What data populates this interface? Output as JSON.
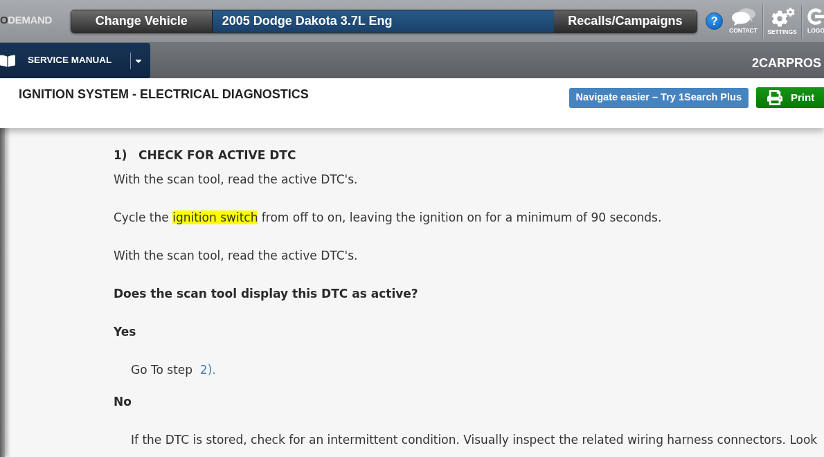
{
  "header": {
    "logo": {
      "prefix": "O",
      "suffix": "DEMAND"
    },
    "change_vehicle": "Change Vehicle",
    "vehicle": "2005 Dodge Dakota 3.7L Eng",
    "recalls": "Recalls/Campaigns",
    "help": "?",
    "actions": [
      {
        "kind": "contact",
        "label": "CONTACT"
      },
      {
        "kind": "settings",
        "label": "SETTINGS"
      },
      {
        "kind": "logout",
        "label": "LOGO"
      }
    ]
  },
  "nav": {
    "module": "SERVICE MANUAL",
    "brand": "2CARPROS"
  },
  "page": {
    "title": "IGNITION SYSTEM - ELECTRICAL DIAGNOSTICS",
    "buttons": [
      {
        "kind": "promo",
        "label": "Navigate easier – Try 1Search Plus"
      },
      {
        "kind": "print",
        "label": "Print"
      }
    ]
  },
  "step": {
    "number": "1)",
    "title": "CHECK FOR ACTIVE DTC",
    "blocks": [
      {
        "kind": "paragraph",
        "segments": [
          {
            "kind": "text",
            "text": "With the scan tool, read the active DTC's."
          }
        ]
      },
      {
        "kind": "paragraph",
        "segments": [
          {
            "kind": "text",
            "text": "Cycle the "
          },
          {
            "kind": "highlight",
            "text": "ignition switch"
          },
          {
            "kind": "text",
            "text": " from off to on, leaving the ignition on for a minimum of 90 seconds."
          }
        ]
      },
      {
        "kind": "paragraph",
        "segments": [
          {
            "kind": "text",
            "text": "With the scan tool, read the active DTC's."
          }
        ]
      },
      {
        "kind": "question",
        "segments": [
          {
            "kind": "text",
            "text": "Does the scan tool display this DTC as active?"
          }
        ]
      },
      {
        "kind": "answer",
        "segments": [
          {
            "kind": "text",
            "text": "Yes"
          }
        ]
      },
      {
        "kind": "indented",
        "segments": [
          {
            "kind": "text",
            "text": "Go To step  "
          },
          {
            "kind": "link",
            "text": "2)."
          }
        ]
      },
      {
        "kind": "answer",
        "segments": [
          {
            "kind": "text",
            "text": "No"
          }
        ]
      },
      {
        "kind": "indented",
        "segments": [
          {
            "kind": "text",
            "text": "If the DTC is stored, check for an intermittent condition. Visually inspect the related wiring harness connectors. Look"
          }
        ]
      }
    ]
  }
}
